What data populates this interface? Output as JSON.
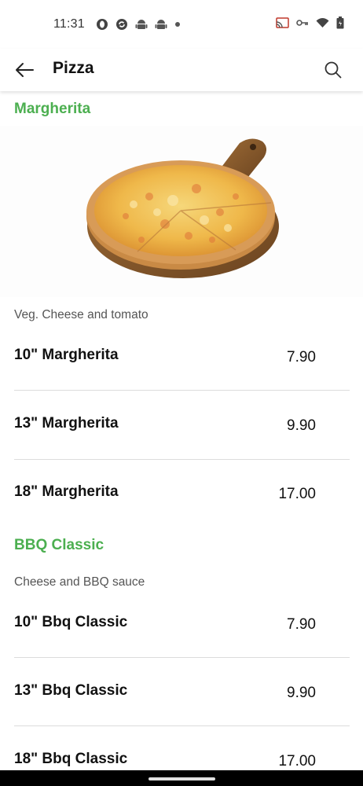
{
  "status_bar": {
    "time": "11:31",
    "left_icons": [
      "opera-icon",
      "sync-icon",
      "android-icon",
      "android-icon",
      "dot-icon"
    ],
    "right_icons": [
      "cast-icon",
      "vpn-key-icon",
      "wifi-icon",
      "battery-icon"
    ]
  },
  "app_bar": {
    "title": "Pizza",
    "back_icon": "arrow-left-icon",
    "search_icon": "search-icon"
  },
  "categories": [
    {
      "title": "Margherita",
      "description": "Veg. Cheese and tomato",
      "items": [
        {
          "name": "10\" Margherita",
          "price": "7.90"
        },
        {
          "name": "13\" Margherita",
          "price": "9.90"
        },
        {
          "name": "18\" Margherita",
          "price": "17.00"
        }
      ]
    },
    {
      "title": "BBQ Classic",
      "description": "Cheese and BBQ sauce",
      "items": [
        {
          "name": "10\" Bbq Classic",
          "price": "7.90"
        },
        {
          "name": "13\" Bbq Classic",
          "price": "9.90"
        },
        {
          "name": "18\" Bbq Classic",
          "price": "17.00"
        }
      ]
    }
  ],
  "colors": {
    "category_title": "#4caf50",
    "text": "#111111",
    "muted": "#555555",
    "divider": "#dcdcdc"
  }
}
